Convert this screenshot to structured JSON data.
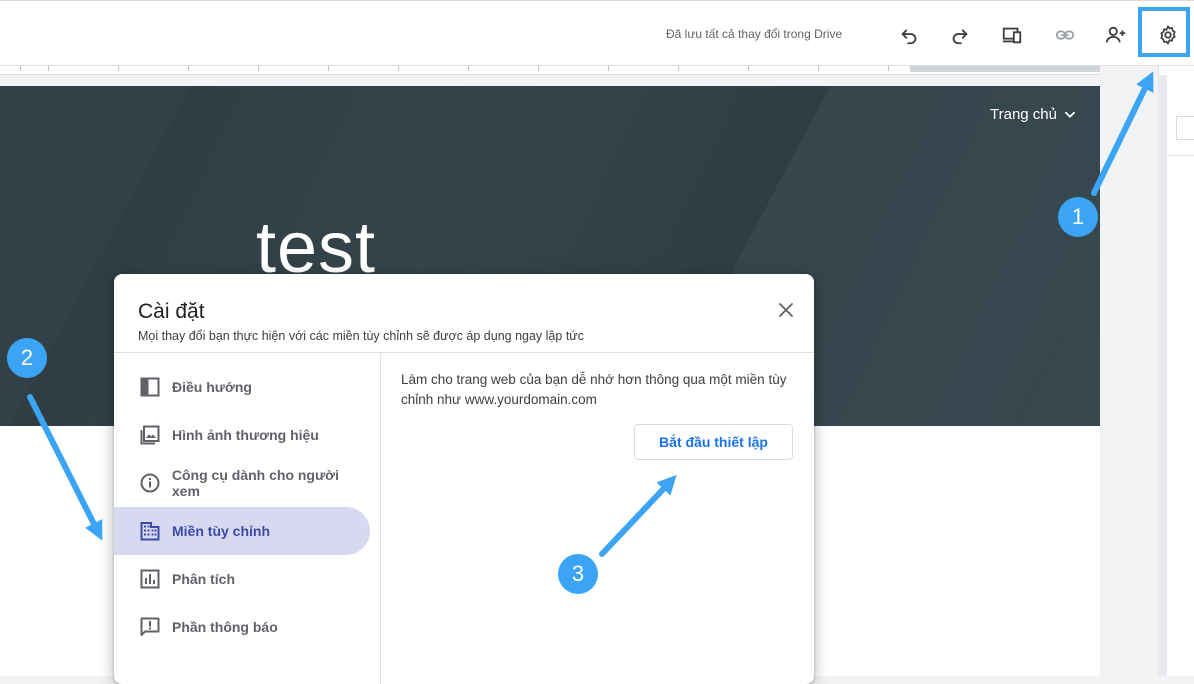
{
  "toolbar": {
    "save_status": "Đã lưu tất cả thay đổi trong Drive",
    "icons": [
      "undo-icon",
      "redo-icon",
      "preview-icon",
      "link-icon",
      "share-icon",
      "settings-icon"
    ]
  },
  "site": {
    "nav_home": "Trang chủ",
    "title": "test"
  },
  "dialog": {
    "title": "Cài đặt",
    "subtitle": "Mọi thay đổi bạn thực hiện với các miền tùy chỉnh sẽ được áp dụng ngay lập tức",
    "menu": [
      {
        "label": "Điều hướng",
        "icon": "navigation-icon"
      },
      {
        "label": "Hình ảnh thương hiệu",
        "icon": "image-icon"
      },
      {
        "label": "Công cụ dành cho người xem",
        "icon": "info-icon"
      },
      {
        "label": "Miền tùy chỉnh",
        "icon": "domain-icon",
        "active": true
      },
      {
        "label": "Phân tích",
        "icon": "analytics-icon"
      },
      {
        "label": "Phần thông báo",
        "icon": "announcement-icon"
      }
    ],
    "description": "Làm cho trang web của bạn dễ nhớ hơn thông qua một miền tùy chỉnh như www.yourdomain.com",
    "setup_button": "Bắt đầu thiết lập"
  },
  "annotations": {
    "step1": "1",
    "step2": "2",
    "step3": "3"
  },
  "colors": {
    "accent": "#3ba4f5",
    "active_bg": "#d6d9ef",
    "active_text": "#3c4ba5",
    "link_blue": "#1a73e8",
    "hero_bg": "#2f3c42"
  }
}
